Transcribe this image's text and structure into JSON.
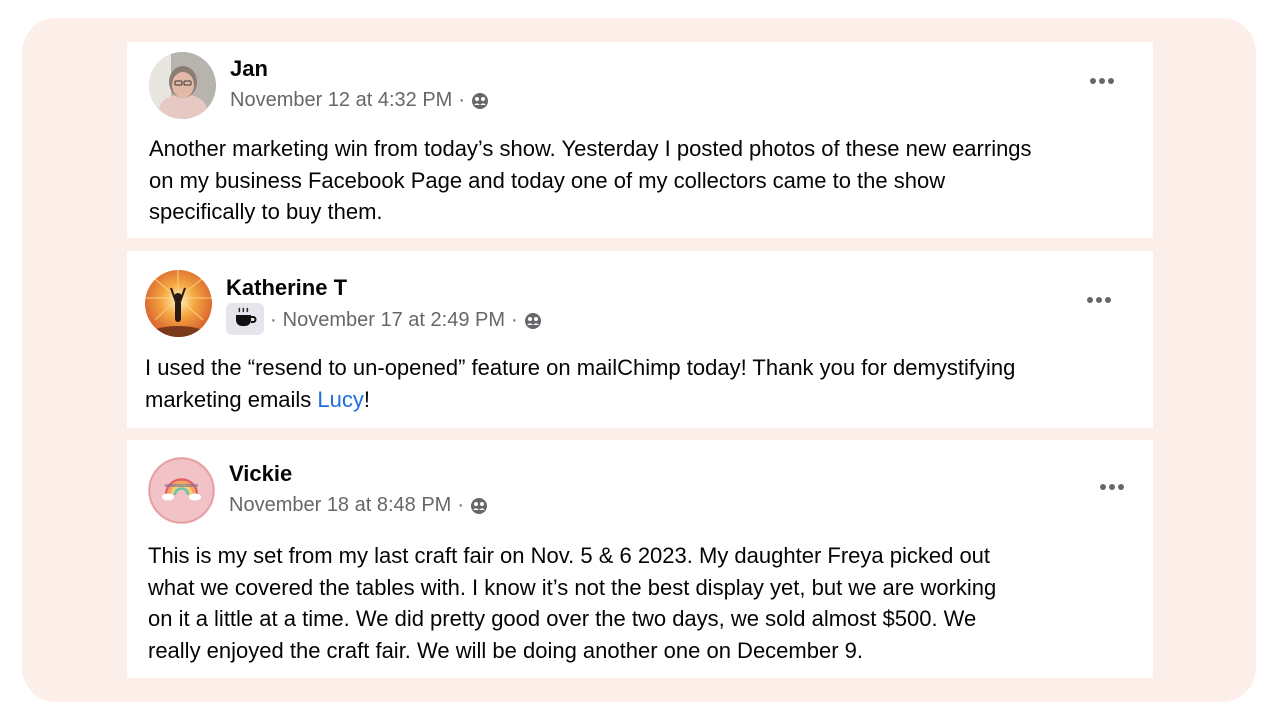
{
  "posts": [
    {
      "author": "Jan",
      "timestamp": "November 12 at 4:32 PM",
      "separator": "·",
      "audience_icon": "friends-audience-icon",
      "text": "Another marketing win from today’s show. Yesterday I posted photos of these new earrings\non my business Facebook Page and today one of my collectors came to the show\nspecifically to buy them."
    },
    {
      "author": "Katherine T",
      "badge_icon": "coffee-cup-icon",
      "timestamp": "November 17 at 2:49 PM",
      "separator": "·",
      "audience_icon": "friends-audience-icon",
      "text_before": "I used the “resend to un-opened” feature on mailChimp today! Thank you for demystifying\nmarketing emails ",
      "mention": "Lucy",
      "text_after": "!"
    },
    {
      "author": "Vickie",
      "timestamp": "November 18 at 8:48 PM",
      "separator": "·",
      "audience_icon": "friends-audience-icon",
      "text": "This is my set from my last craft fair on Nov. 5 & 6 2023. My daughter Freya picked out\nwhat we covered the tables with.  I know it’s not the best display yet, but we are working\non it a little at a time. We did pretty good over the two days, we sold almost $500. We\nreally enjoyed the craft fair. We will be doing another one on December 9."
    }
  ],
  "colors": {
    "frame_background": "#fcefea",
    "name_text": "#050505",
    "meta_text": "#65676b",
    "mention_link": "#216fdb"
  }
}
